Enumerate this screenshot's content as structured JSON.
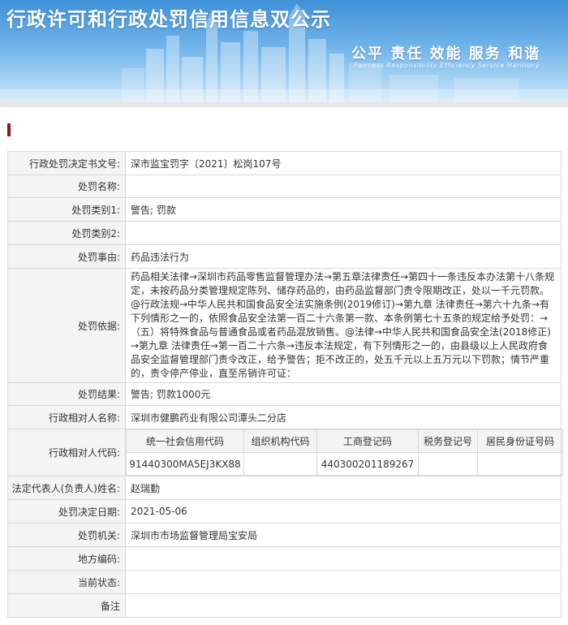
{
  "banner": {
    "title": "行政许可和行政处罚信用信息双公示",
    "slogan": "公平  责任  效能  服务  和谐",
    "slogan_en": "Fairness  Responsibility  Efficiency  Service  Harmony"
  },
  "record": {
    "decision_no": {
      "label": "行政处罚决定书文号:",
      "value": "深市监宝罚字〔2021〕松岗107号"
    },
    "penalty_name": {
      "label": "处罚名称:",
      "value": ""
    },
    "category1": {
      "label": "处罚类别1:",
      "value": "警告; 罚款"
    },
    "category2": {
      "label": "处罚类别2:",
      "value": ""
    },
    "reason": {
      "label": "处罚事由:",
      "value": "药品违法行为"
    },
    "basis": {
      "label": "处罚依据:",
      "value": "药品相关法律→深圳市药品零售监督管理办法→第五章法律责任→第四十一条违反本办法第十八条规定，未按药品分类管理规定陈列、储存药品的，由药品监督部门责令限期改正，处以一千元罚款。@行政法规→中华人民共和国食品安全法实施条例(2019修订)→第九章 法律责任→第六十九条→有下列情形之一的，依照食品安全法第一百二十六条第一款、本条例第七十五条的规定给予处罚：→（五）将特殊食品与普通食品或者药品混放销售。@法律→中华人民共和国食品安全法(2018修正)→第九章 法律责任→第一百二十六条→违反本法规定，有下列情形之一的，由县级以上人民政府食品安全监督管理部门责令改正，给予警告；拒不改正的，处五千元以上五万元以下罚款；情节严重的，责令停产停业，直至吊销许可证："
    },
    "result": {
      "label": "处罚结果:",
      "value": "警告; 罚款1000元"
    },
    "party_name": {
      "label": "行政相对人名称:",
      "value": "深圳市健鹏药业有限公司潭头二分店"
    },
    "party_code": {
      "label": "行政相对人代码:",
      "headers": [
        "统一社会信用代码",
        "组织机构代码",
        "工商登记码",
        "税务登记号",
        "居民身份证号码"
      ],
      "values": [
        "91440300MA5EJ3KX88",
        "",
        "440300201189267",
        "",
        ""
      ]
    },
    "legal_rep": {
      "label": "法定代表人(负责人)姓名:",
      "value": "赵瑞勤"
    },
    "decision_date": {
      "label": "处罚决定日期:",
      "value": "2021-05-06"
    },
    "authority": {
      "label": "处罚机关:",
      "value": "深圳市市场监督管理局宝安局"
    },
    "local_code": {
      "label": "地方编码:",
      "value": ""
    },
    "status": {
      "label": "当前状态:",
      "value": ""
    },
    "remark": {
      "label": "备注",
      "value": ""
    }
  }
}
